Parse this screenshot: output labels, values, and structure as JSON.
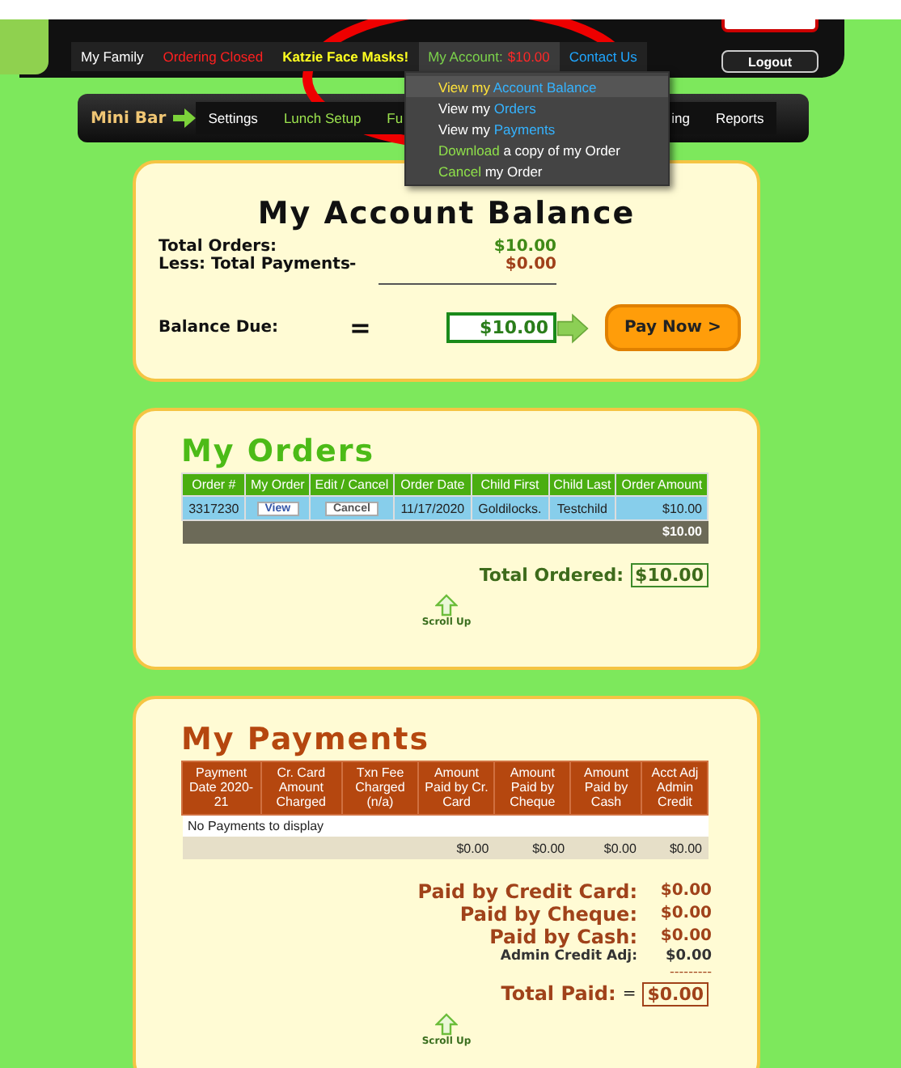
{
  "header": {
    "logout": "Logout",
    "nav": [
      {
        "kind": "plain",
        "text": "My Family",
        "selected": false
      },
      {
        "kind": "alert",
        "text": "Ordering Closed",
        "selected": false
      },
      {
        "kind": "promo",
        "text": "Katzie Face Masks!",
        "selected": false
      },
      {
        "kind": "account",
        "text": "My Account:",
        "amount": "$10.00",
        "selected": true
      },
      {
        "kind": "link",
        "text": "Contact Us",
        "selected": false
      }
    ]
  },
  "account_menu": [
    {
      "selected": true,
      "parts": [
        {
          "kind": "plain",
          "text": "View my"
        },
        {
          "kind": "link",
          "text": "Account Balance"
        }
      ]
    },
    {
      "selected": false,
      "parts": [
        {
          "kind": "plain",
          "text": "View my"
        },
        {
          "kind": "link",
          "text": "Orders"
        }
      ]
    },
    {
      "selected": false,
      "parts": [
        {
          "kind": "plain",
          "text": "View my"
        },
        {
          "kind": "link",
          "text": "Payments"
        }
      ]
    },
    {
      "selected": false,
      "parts": [
        {
          "kind": "action",
          "text": "Download"
        },
        {
          "kind": "plain",
          "text": "a copy of my Order"
        }
      ]
    },
    {
      "selected": false,
      "parts": [
        {
          "kind": "action",
          "text": "Cancel"
        },
        {
          "kind": "plain",
          "text": "my Order"
        }
      ]
    }
  ],
  "mini_bar": {
    "label": "Mini Bar",
    "items_before": [
      {
        "text": "Settings",
        "kind": "plain"
      },
      {
        "text": "Lunch Setup",
        "kind": "green"
      },
      {
        "text": "Fu",
        "kind": "green"
      }
    ],
    "items_after": [
      {
        "text": "ing"
      },
      {
        "text": "Reports"
      }
    ]
  },
  "balance": {
    "title": "My Account Balance",
    "total_orders_label": "Total Orders:",
    "total_orders": "$10.00",
    "payments_label": "Less: Total Payments",
    "minus": "-",
    "payments": "$0.00",
    "due_label": "Balance Due:",
    "equals": "=",
    "due": "$10.00",
    "pay_button": "Pay Now >"
  },
  "orders": {
    "title": "My Orders",
    "columns": [
      "Order #",
      "My Order",
      "Edit / Cancel",
      "Order Date",
      "Child First",
      "Child Last",
      "Order Amount"
    ],
    "rows": [
      {
        "order": "3317230",
        "view": "View",
        "cancel": "Cancel",
        "date": "11/17/2020",
        "first": "Goldilocks.",
        "last": "Testchild",
        "amount": "$10.00"
      }
    ],
    "total": "$10.00",
    "total_label": "Total Ordered:",
    "total_value": "$10.00",
    "scroll_up": "Scroll Up"
  },
  "payments": {
    "title": "My Payments",
    "columns": [
      "Payment Date 2020-21",
      "Cr. Card Amount Charged",
      "Txn Fee Charged (n/a)",
      "Amount Paid by Cr. Card",
      "Amount Paid by Cheque",
      "Amount Paid by Cash",
      "Acct Adj Admin Credit"
    ],
    "empty": "No Payments to display",
    "totals": [
      "$0.00",
      "$0.00",
      "$0.00",
      "$0.00"
    ],
    "summary": [
      {
        "kind": "big",
        "label": "Paid by Credit Card:",
        "value": "$0.00"
      },
      {
        "kind": "big",
        "label": "Paid by Cheque:",
        "value": "$0.00"
      },
      {
        "kind": "big",
        "label": "Paid by Cash:",
        "value": "$0.00"
      },
      {
        "kind": "small",
        "label": "Admin Credit Adj:",
        "value": "$0.00"
      }
    ],
    "dashes": "---------",
    "total_label": "Total Paid:",
    "equals": "=",
    "total_value": "$0.00",
    "scroll_up": "Scroll Up"
  }
}
